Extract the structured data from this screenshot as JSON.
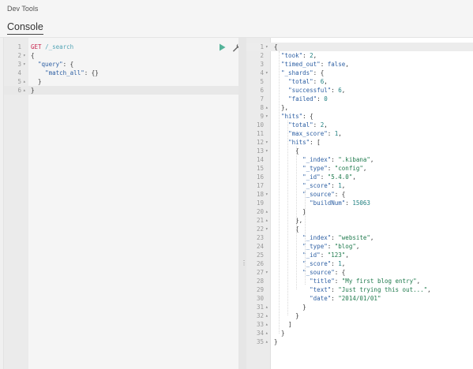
{
  "header": {
    "breadcrumb": "Dev Tools",
    "tab_label": "Console"
  },
  "request": {
    "lines": [
      {
        "n": "1",
        "fold": "",
        "text": [
          [
            "m",
            "GET"
          ],
          [
            "p",
            " "
          ],
          [
            "u",
            "/_search"
          ]
        ]
      },
      {
        "n": "2",
        "fold": "▾",
        "text": [
          [
            "p",
            "{"
          ]
        ]
      },
      {
        "n": "3",
        "fold": "▾",
        "text": [
          [
            "p",
            "  "
          ],
          [
            "k",
            "\"query\""
          ],
          [
            "p",
            ": {"
          ]
        ]
      },
      {
        "n": "4",
        "fold": "",
        "text": [
          [
            "p",
            "    "
          ],
          [
            "k",
            "\"match_all\""
          ],
          [
            "p",
            ": {}"
          ]
        ]
      },
      {
        "n": "5",
        "fold": "▴",
        "text": [
          [
            "p",
            "  }"
          ]
        ]
      },
      {
        "n": "6",
        "fold": "▴",
        "text": [
          [
            "p",
            "}"
          ]
        ],
        "active": true
      }
    ],
    "tools": {
      "run": "run-icon",
      "settings": "wrench-icon"
    }
  },
  "response": {
    "lines": [
      {
        "n": "1",
        "fold": "▾",
        "text": [
          [
            "p",
            "{"
          ]
        ],
        "active": true
      },
      {
        "n": "2",
        "fold": "",
        "text": [
          [
            "p",
            "  "
          ],
          [
            "k",
            "\"took\""
          ],
          [
            "p",
            ": "
          ],
          [
            "n",
            "2"
          ],
          [
            "p",
            ","
          ]
        ]
      },
      {
        "n": "3",
        "fold": "",
        "text": [
          [
            "p",
            "  "
          ],
          [
            "k",
            "\"timed_out\""
          ],
          [
            "p",
            ": "
          ],
          [
            "b",
            "false"
          ],
          [
            "p",
            ","
          ]
        ]
      },
      {
        "n": "4",
        "fold": "▾",
        "text": [
          [
            "p",
            "  "
          ],
          [
            "k",
            "\"_shards\""
          ],
          [
            "p",
            ": {"
          ]
        ]
      },
      {
        "n": "5",
        "fold": "",
        "text": [
          [
            "p",
            "    "
          ],
          [
            "k",
            "\"total\""
          ],
          [
            "p",
            ": "
          ],
          [
            "n",
            "6"
          ],
          [
            "p",
            ","
          ]
        ]
      },
      {
        "n": "6",
        "fold": "",
        "text": [
          [
            "p",
            "    "
          ],
          [
            "k",
            "\"successful\""
          ],
          [
            "p",
            ": "
          ],
          [
            "n",
            "6"
          ],
          [
            "p",
            ","
          ]
        ]
      },
      {
        "n": "7",
        "fold": "",
        "text": [
          [
            "p",
            "    "
          ],
          [
            "k",
            "\"failed\""
          ],
          [
            "p",
            ": "
          ],
          [
            "n",
            "0"
          ]
        ]
      },
      {
        "n": "8",
        "fold": "▴",
        "text": [
          [
            "p",
            "  },"
          ]
        ]
      },
      {
        "n": "9",
        "fold": "▾",
        "text": [
          [
            "p",
            "  "
          ],
          [
            "k",
            "\"hits\""
          ],
          [
            "p",
            ": {"
          ]
        ]
      },
      {
        "n": "10",
        "fold": "",
        "text": [
          [
            "p",
            "    "
          ],
          [
            "k",
            "\"total\""
          ],
          [
            "p",
            ": "
          ],
          [
            "n",
            "2"
          ],
          [
            "p",
            ","
          ]
        ]
      },
      {
        "n": "11",
        "fold": "",
        "text": [
          [
            "p",
            "    "
          ],
          [
            "k",
            "\"max_score\""
          ],
          [
            "p",
            ": "
          ],
          [
            "n",
            "1"
          ],
          [
            "p",
            ","
          ]
        ]
      },
      {
        "n": "12",
        "fold": "▾",
        "text": [
          [
            "p",
            "    "
          ],
          [
            "k",
            "\"hits\""
          ],
          [
            "p",
            ": ["
          ]
        ]
      },
      {
        "n": "13",
        "fold": "▾",
        "text": [
          [
            "p",
            "      {"
          ]
        ]
      },
      {
        "n": "14",
        "fold": "",
        "text": [
          [
            "p",
            "        "
          ],
          [
            "k",
            "\"_index\""
          ],
          [
            "p",
            ": "
          ],
          [
            "s",
            "\".kibana\""
          ],
          [
            "p",
            ","
          ]
        ]
      },
      {
        "n": "15",
        "fold": "",
        "text": [
          [
            "p",
            "        "
          ],
          [
            "k",
            "\"_type\""
          ],
          [
            "p",
            ": "
          ],
          [
            "s",
            "\"config\""
          ],
          [
            "p",
            ","
          ]
        ]
      },
      {
        "n": "16",
        "fold": "",
        "text": [
          [
            "p",
            "        "
          ],
          [
            "k",
            "\"_id\""
          ],
          [
            "p",
            ": "
          ],
          [
            "s",
            "\"5.4.0\""
          ],
          [
            "p",
            ","
          ]
        ]
      },
      {
        "n": "17",
        "fold": "",
        "text": [
          [
            "p",
            "        "
          ],
          [
            "k",
            "\"_score\""
          ],
          [
            "p",
            ": "
          ],
          [
            "n",
            "1"
          ],
          [
            "p",
            ","
          ]
        ]
      },
      {
        "n": "18",
        "fold": "▾",
        "text": [
          [
            "p",
            "        "
          ],
          [
            "k",
            "\"_source\""
          ],
          [
            "p",
            ": {"
          ]
        ]
      },
      {
        "n": "19",
        "fold": "",
        "text": [
          [
            "p",
            "          "
          ],
          [
            "k",
            "\"buildNum\""
          ],
          [
            "p",
            ": "
          ],
          [
            "n",
            "15063"
          ]
        ]
      },
      {
        "n": "20",
        "fold": "▴",
        "text": [
          [
            "p",
            "        }"
          ]
        ]
      },
      {
        "n": "21",
        "fold": "▴",
        "text": [
          [
            "p",
            "      },"
          ]
        ]
      },
      {
        "n": "22",
        "fold": "▾",
        "text": [
          [
            "p",
            "      {"
          ]
        ]
      },
      {
        "n": "23",
        "fold": "",
        "text": [
          [
            "p",
            "        "
          ],
          [
            "k",
            "\"_index\""
          ],
          [
            "p",
            ": "
          ],
          [
            "s",
            "\"website\""
          ],
          [
            "p",
            ","
          ]
        ]
      },
      {
        "n": "24",
        "fold": "",
        "text": [
          [
            "p",
            "        "
          ],
          [
            "k",
            "\"_type\""
          ],
          [
            "p",
            ": "
          ],
          [
            "s",
            "\"blog\""
          ],
          [
            "p",
            ","
          ]
        ]
      },
      {
        "n": "25",
        "fold": "",
        "text": [
          [
            "p",
            "        "
          ],
          [
            "k",
            "\"_id\""
          ],
          [
            "p",
            ": "
          ],
          [
            "s",
            "\"123\""
          ],
          [
            "p",
            ","
          ]
        ]
      },
      {
        "n": "26",
        "fold": "",
        "text": [
          [
            "p",
            "        "
          ],
          [
            "k",
            "\"_score\""
          ],
          [
            "p",
            ": "
          ],
          [
            "n",
            "1"
          ],
          [
            "p",
            ","
          ]
        ]
      },
      {
        "n": "27",
        "fold": "▾",
        "text": [
          [
            "p",
            "        "
          ],
          [
            "k",
            "\"_source\""
          ],
          [
            "p",
            ": {"
          ]
        ]
      },
      {
        "n": "28",
        "fold": "",
        "text": [
          [
            "p",
            "          "
          ],
          [
            "k",
            "\"title\""
          ],
          [
            "p",
            ": "
          ],
          [
            "s",
            "\"My first blog entry\""
          ],
          [
            "p",
            ","
          ]
        ]
      },
      {
        "n": "29",
        "fold": "",
        "text": [
          [
            "p",
            "          "
          ],
          [
            "k",
            "\"text\""
          ],
          [
            "p",
            ": "
          ],
          [
            "s",
            "\"Just trying this out...\""
          ],
          [
            "p",
            ","
          ]
        ]
      },
      {
        "n": "30",
        "fold": "",
        "text": [
          [
            "p",
            "          "
          ],
          [
            "k",
            "\"date\""
          ],
          [
            "p",
            ": "
          ],
          [
            "s",
            "\"2014/01/01\""
          ]
        ]
      },
      {
        "n": "31",
        "fold": "▴",
        "text": [
          [
            "p",
            "        }"
          ]
        ]
      },
      {
        "n": "32",
        "fold": "▴",
        "text": [
          [
            "p",
            "      }"
          ]
        ]
      },
      {
        "n": "33",
        "fold": "▴",
        "text": [
          [
            "p",
            "    ]"
          ]
        ]
      },
      {
        "n": "34",
        "fold": "▴",
        "text": [
          [
            "p",
            "  }"
          ]
        ]
      },
      {
        "n": "35",
        "fold": "▴",
        "text": [
          [
            "p",
            "}"
          ]
        ]
      }
    ]
  },
  "colors": {
    "key": "#2d5fa3",
    "string": "#1f7a4d",
    "number": "#208080",
    "method": "#c7254e",
    "run_icon": "#54b399"
  }
}
